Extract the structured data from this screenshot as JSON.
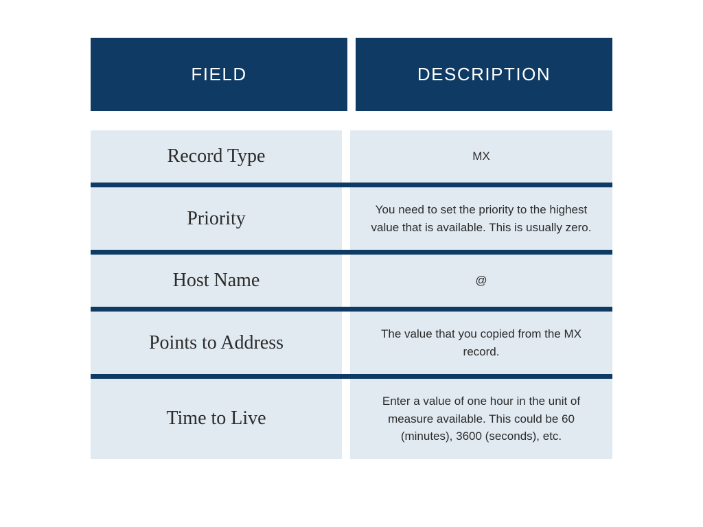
{
  "headers": {
    "field": "FIELD",
    "description": "DESCRIPTION"
  },
  "rows": [
    {
      "field": "Record Type",
      "description": "MX"
    },
    {
      "field": "Priority",
      "description": "You need to set the priority to the highest value that is available. This is usually zero."
    },
    {
      "field": "Host Name",
      "description": "@"
    },
    {
      "field": "Points to Address",
      "description": "The value that you copied from the MX record."
    },
    {
      "field": "Time to Live",
      "description": "Enter a value of one hour in the unit of measure available. This could be 60 (minutes), 3600 (seconds), etc."
    }
  ]
}
